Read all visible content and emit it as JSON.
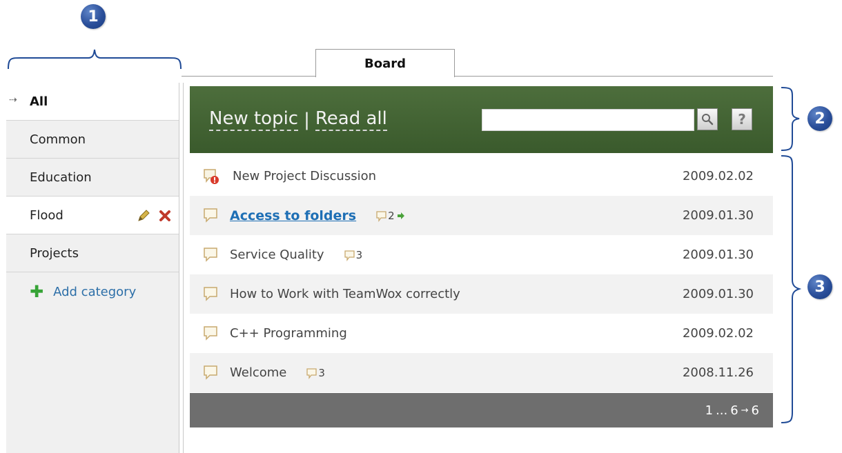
{
  "callouts": [
    "1",
    "2",
    "3"
  ],
  "tab": {
    "label": "Board"
  },
  "sidebar": {
    "items": [
      {
        "label": "All",
        "active": true
      },
      {
        "label": "Common"
      },
      {
        "label": "Education"
      },
      {
        "label": "Flood",
        "selected": true,
        "actions": [
          "pencil-icon",
          "delete-icon"
        ]
      },
      {
        "label": "Projects"
      }
    ],
    "add_label": "Add category"
  },
  "header": {
    "new_topic": "New topic",
    "separator": "|",
    "read_all": "Read all",
    "search_value": "",
    "help_label": "?"
  },
  "topics": [
    {
      "title": "New Project Discussion",
      "date": "2009.02.02",
      "icon": "topic-unread-icon"
    },
    {
      "title": "Access to folders",
      "count": "2",
      "date": "2009.01.30",
      "new": true,
      "icon": "topic-icon"
    },
    {
      "title": "Service Quality",
      "count": "3",
      "date": "2009.01.30",
      "icon": "topic-icon"
    },
    {
      "title": "How to Work with TeamWox correctly",
      "date": "2009.01.30",
      "icon": "topic-icon"
    },
    {
      "title": "C++ Programming",
      "date": "2009.02.02",
      "icon": "topic-icon"
    },
    {
      "title": "Welcome",
      "count": "3",
      "date": "2008.11.26",
      "icon": "topic-icon"
    }
  ],
  "pager": {
    "first": "1",
    "ellipsis": "...",
    "current": "6",
    "arrow": "→",
    "last": "6"
  },
  "colors": {
    "header_bg": "#3f5f31",
    "badge": "#2b4f9a",
    "link": "#1e6fb5",
    "pager_bg": "#6e6e6e"
  }
}
